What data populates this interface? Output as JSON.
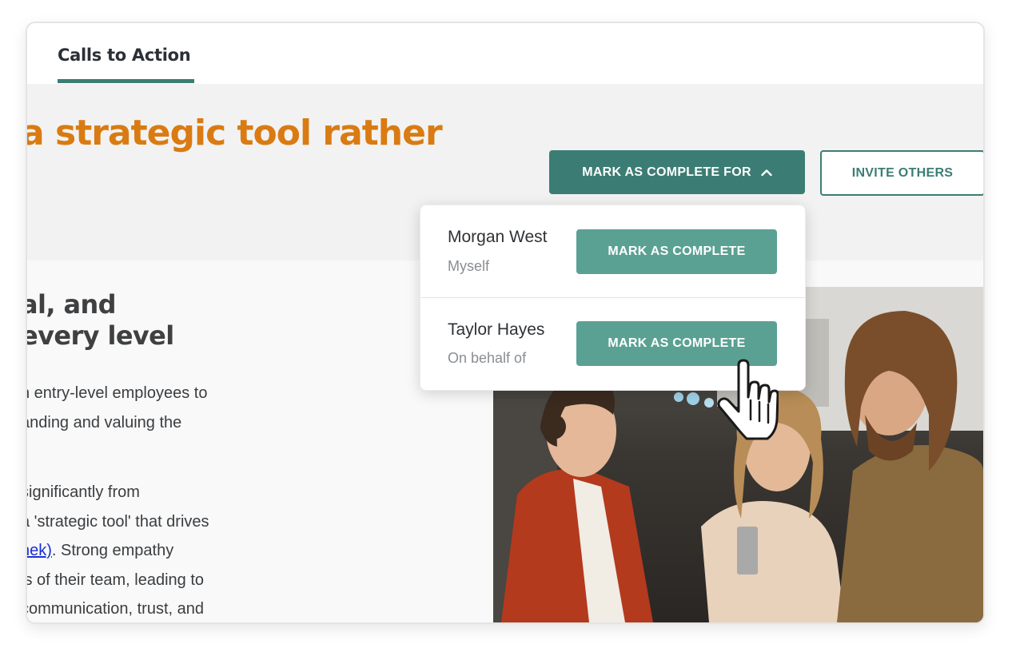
{
  "tabs": {
    "active_label": "Calls to Action"
  },
  "hero": {
    "title": "a strategic tool rather"
  },
  "actions": {
    "mark_complete_for_label": "MARK AS COMPLETE FOR",
    "invite_label": "INVITE OTHERS"
  },
  "content": {
    "heading_line1": "al, and",
    "heading_line2": "every level",
    "para1": [
      "n entry-level employees to",
      "anding and valuing the"
    ],
    "para2_line1": "significantly from",
    "para2_line2": "a 'strategic tool' that drives",
    "para2_link": "nek)",
    "para2_line3_rest": ". Strong empathy",
    "para2_line4": "ls of their team, leading to",
    "para2_line5": "communication, trust, and"
  },
  "dropdown": {
    "items": [
      {
        "name": "Morgan West",
        "relation": "Myself",
        "button": "MARK AS COMPLETE"
      },
      {
        "name": "Taylor Hayes",
        "relation": "On behalf of",
        "button": "MARK AS COMPLETE"
      }
    ]
  },
  "colors": {
    "accent": "#3b7d74",
    "accent_light": "#5ba193",
    "title_orange": "#d97b12"
  },
  "icons": [
    "chevron-up-icon",
    "hand-pointer-cursor-icon"
  ]
}
